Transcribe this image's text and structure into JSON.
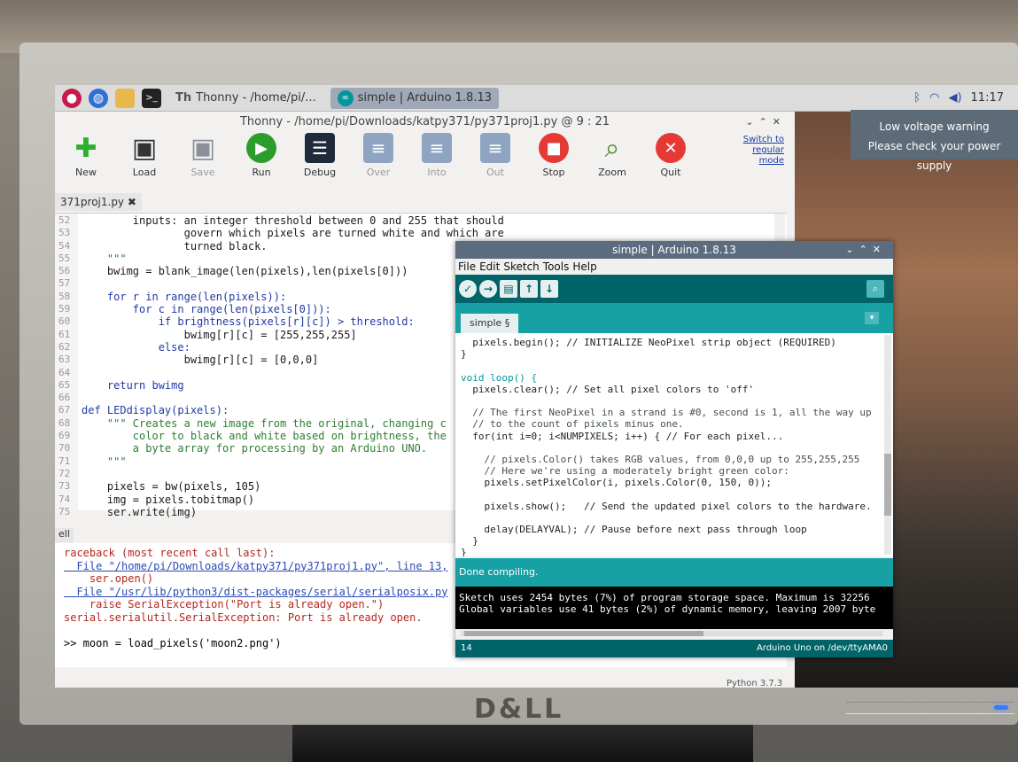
{
  "taskbar": {
    "tasks": [
      {
        "label": "Thonny  -  /home/pi/..."
      },
      {
        "label": "simple | Arduino 1.8.13"
      }
    ],
    "clock": "11:17"
  },
  "low_voltage": {
    "title": "Low voltage warning",
    "message": "Please check your power supply"
  },
  "thonny": {
    "title": "Thonny  -  /home/pi/Downloads/katpy371/py371proj1.py  @  9 : 21",
    "toolbar": [
      {
        "label": "New",
        "icon": "plus-icon",
        "color": "#2fae2f",
        "enabled": true
      },
      {
        "label": "Load",
        "icon": "load-icon",
        "color": "#333333",
        "enabled": true
      },
      {
        "label": "Save",
        "icon": "save-icon",
        "color": "#8a8f99",
        "enabled": false
      },
      {
        "label": "Run",
        "icon": "run-icon",
        "color": "#2a9d2a",
        "enabled": true
      },
      {
        "label": "Debug",
        "icon": "debug-icon",
        "color": "#1f2a3a",
        "enabled": true
      },
      {
        "label": "Over",
        "icon": "step-over-icon",
        "color": "#8ea4c0",
        "enabled": false
      },
      {
        "label": "Into",
        "icon": "step-into-icon",
        "color": "#8ea4c0",
        "enabled": false
      },
      {
        "label": "Out",
        "icon": "step-out-icon",
        "color": "#8ea4c0",
        "enabled": false
      },
      {
        "label": "Stop",
        "icon": "stop-icon",
        "color": "#e53935",
        "enabled": true
      },
      {
        "label": "Zoom",
        "icon": "zoom-icon",
        "color": "#5a8a3a",
        "enabled": true
      },
      {
        "label": "Quit",
        "icon": "quit-icon",
        "color": "#e53935",
        "enabled": true
      }
    ],
    "switch_mode": [
      "Switch to",
      "regular",
      "mode"
    ],
    "editor_tab": "371proj1.py",
    "line_numbers": [
      "52",
      "53",
      "54",
      "55",
      "56",
      "57",
      "58",
      "59",
      "60",
      "61",
      "62",
      "63",
      "64",
      "65",
      "66",
      "67",
      "68",
      "69",
      "70",
      "71",
      "72",
      "73",
      "74",
      "75"
    ],
    "code_lines": [
      "        inputs: an integer threshold between 0 and 255 that should",
      "                govern which pixels are turned white and which are",
      "                turned black.",
      "    \"\"\"",
      "    bwimg = blank_image(len(pixels),len(pixels[0]))",
      "",
      "    for r in range(len(pixels)):",
      "        for c in range(len(pixels[0])):",
      "            if brightness(pixels[r][c]) > threshold:",
      "                bwimg[r][c] = [255,255,255]",
      "            else:",
      "                bwimg[r][c] = [0,0,0]",
      "",
      "    return bwimg",
      "",
      "def LEDdisplay(pixels):",
      "    \"\"\" Creates a new image from the original, changing c",
      "        color to black and white based on brightness, the",
      "        a byte array for processing by an Arduino UNO.",
      "    \"\"\"",
      "",
      "    pixels = bw(pixels, 105)",
      "    img = pixels.tobitmap()",
      "    ser.write(img)"
    ],
    "shell_tab": "ell",
    "shell_lines": [
      "raceback (most recent call last):",
      "  File \"/home/pi/Downloads/katpy371/py371proj1.py\", line 13,",
      "    ser.open()",
      "  File \"/usr/lib/python3/dist-packages/serial/serialposix.py",
      "    raise SerialException(\"Port is already open.\")",
      "serial.serialutil.SerialException: Port is already open.",
      "",
      ">> moon = load_pixels('moon2.png')"
    ],
    "python_version": "Python 3.7.3"
  },
  "arduino": {
    "title": "simple | Arduino 1.8.13",
    "menu": [
      "File",
      "Edit",
      "Sketch",
      "Tools",
      "Help"
    ],
    "tab": "simple §",
    "code_lines": [
      "  pixels.begin(); // INITIALIZE NeoPixel strip object (REQUIRED)",
      "}",
      "",
      "void loop() {",
      "  pixels.clear(); // Set all pixel colors to 'off'",
      "",
      "  // The first NeoPixel in a strand is #0, second is 1, all the way up",
      "  // to the count of pixels minus one.",
      "  for(int i=0; i<NUMPIXELS; i++) { // For each pixel...",
      "",
      "    // pixels.Color() takes RGB values, from 0,0,0 up to 255,255,255",
      "    // Here we're using a moderately bright green color:",
      "    pixels.setPixelColor(i, pixels.Color(0, 150, 0));",
      "",
      "    pixels.show();   // Send the updated pixel colors to the hardware.",
      "",
      "    delay(DELAYVAL); // Pause before next pass through loop",
      "  }",
      "}"
    ],
    "status": "Done compiling.",
    "console_lines": [
      "Sketch uses 2454 bytes (7%) of program storage space. Maximum is 32256",
      "Global variables use 41 bytes (2%) of dynamic memory, leaving 2007 byte"
    ],
    "footer_line": "14",
    "footer_board": "Arduino Uno on /dev/ttyAMA0",
    "colors": {
      "teal_dark": "#006468",
      "teal": "#17a1a5"
    }
  },
  "monitor": {
    "brand": "D&LL"
  }
}
